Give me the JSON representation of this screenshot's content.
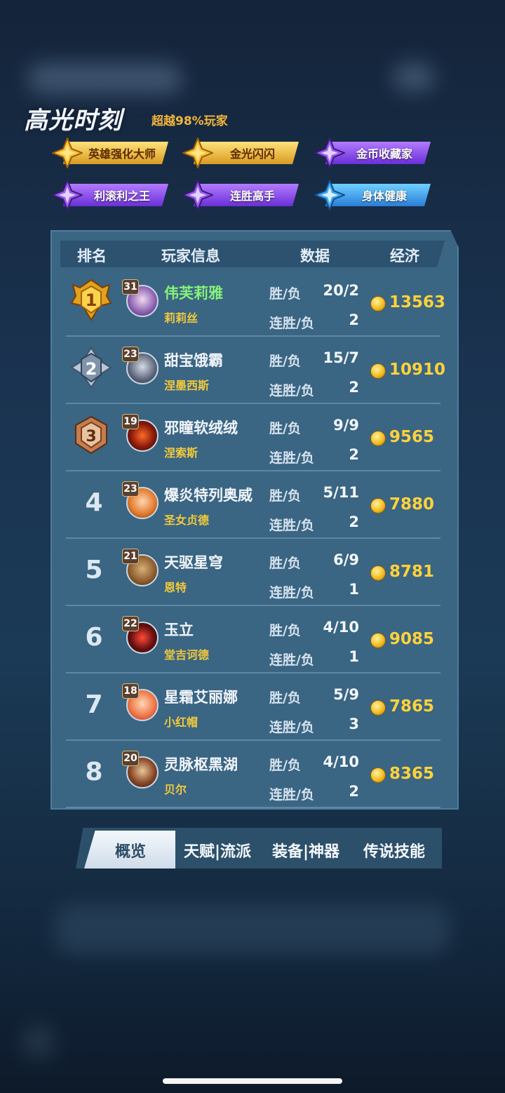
{
  "highlight": {
    "title": "高光时刻",
    "subtitle": "超越98%玩家",
    "badges": [
      {
        "label": "英雄强化大师",
        "style": "gold"
      },
      {
        "label": "金光闪闪",
        "style": "gold"
      },
      {
        "label": "金币收藏家",
        "style": "purple"
      },
      {
        "label": "利滚利之王",
        "style": "purple"
      },
      {
        "label": "连胜高手",
        "style": "purple"
      },
      {
        "label": "身体健康",
        "style": "blue"
      }
    ]
  },
  "table": {
    "headers": {
      "rank": "排名",
      "player": "玩家信息",
      "data": "数据",
      "economy": "经济"
    },
    "win_loss_label": "胜/负",
    "streak_label": "连胜/负",
    "rows": [
      {
        "rank": "1",
        "level": "31",
        "name": "伟芙莉雅",
        "hero": "莉莉丝",
        "win_loss": "20/2",
        "streak": "2",
        "economy": "13563"
      },
      {
        "rank": "2",
        "level": "23",
        "name": "甜宝饿霸",
        "hero": "涅墨西斯",
        "win_loss": "15/7",
        "streak": "2",
        "economy": "10910"
      },
      {
        "rank": "3",
        "level": "19",
        "name": "邪瞳软绒绒",
        "hero": "涅索斯",
        "win_loss": "9/9",
        "streak": "2",
        "economy": "9565"
      },
      {
        "rank": "4",
        "level": "23",
        "name": "爆炎特列奥威",
        "hero": "圣女贞德",
        "win_loss": "5/11",
        "streak": "2",
        "economy": "7880"
      },
      {
        "rank": "5",
        "level": "21",
        "name": "天驱星穹",
        "hero": "恩特",
        "win_loss": "6/9",
        "streak": "1",
        "economy": "8781"
      },
      {
        "rank": "6",
        "level": "22",
        "name": " 玉立",
        "hero": "堂吉诃德",
        "win_loss": "4/10",
        "streak": "1",
        "economy": "9085"
      },
      {
        "rank": "7",
        "level": "18",
        "name": "星霜艾丽娜",
        "hero": "小红帽",
        "win_loss": "5/9",
        "streak": "3",
        "economy": "7865"
      },
      {
        "rank": "8",
        "level": "20",
        "name": "灵脉枢黑湖",
        "hero": "贝尔",
        "win_loss": "4/10",
        "streak": "2",
        "economy": "8365"
      }
    ]
  },
  "tabs": [
    "概览",
    "天赋|流派",
    "装备|神器",
    "传说技能"
  ],
  "active_tab": "概览",
  "colors": {
    "coin": "#f3bd23",
    "economy": "#ffd23c",
    "mvp_name": "#86f27a",
    "hero_name": "#f3c93c"
  }
}
